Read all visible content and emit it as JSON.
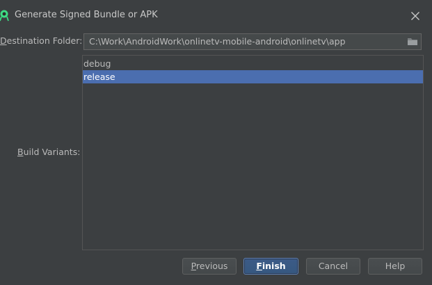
{
  "window": {
    "title": "Generate Signed Bundle or APK"
  },
  "form": {
    "destination_label_mnemonic": "D",
    "destination_label_rest": "estination Folder:",
    "destination_path": "C:\\Work\\AndroidWork\\onlinetv-mobile-android\\onlinetv\\app",
    "build_variants_label_mnemonic": "B",
    "build_variants_label_rest": "uild Variants:",
    "build_variants": [
      {
        "label": "debug",
        "selected": false
      },
      {
        "label": "release",
        "selected": true
      }
    ]
  },
  "buttons": {
    "previous_mnemonic": "P",
    "previous_rest": "revious",
    "finish_mnemonic": "F",
    "finish_rest": "inish",
    "cancel": "Cancel",
    "help": "Help"
  },
  "colors": {
    "background": "#3c3f41",
    "selection": "#4b6eaf",
    "default_button": "#365880",
    "text": "#bbbbbb",
    "app_icon": "#3ddc84"
  },
  "icons": {
    "app": "android-studio-icon",
    "close": "close-icon",
    "folder": "folder-icon"
  }
}
